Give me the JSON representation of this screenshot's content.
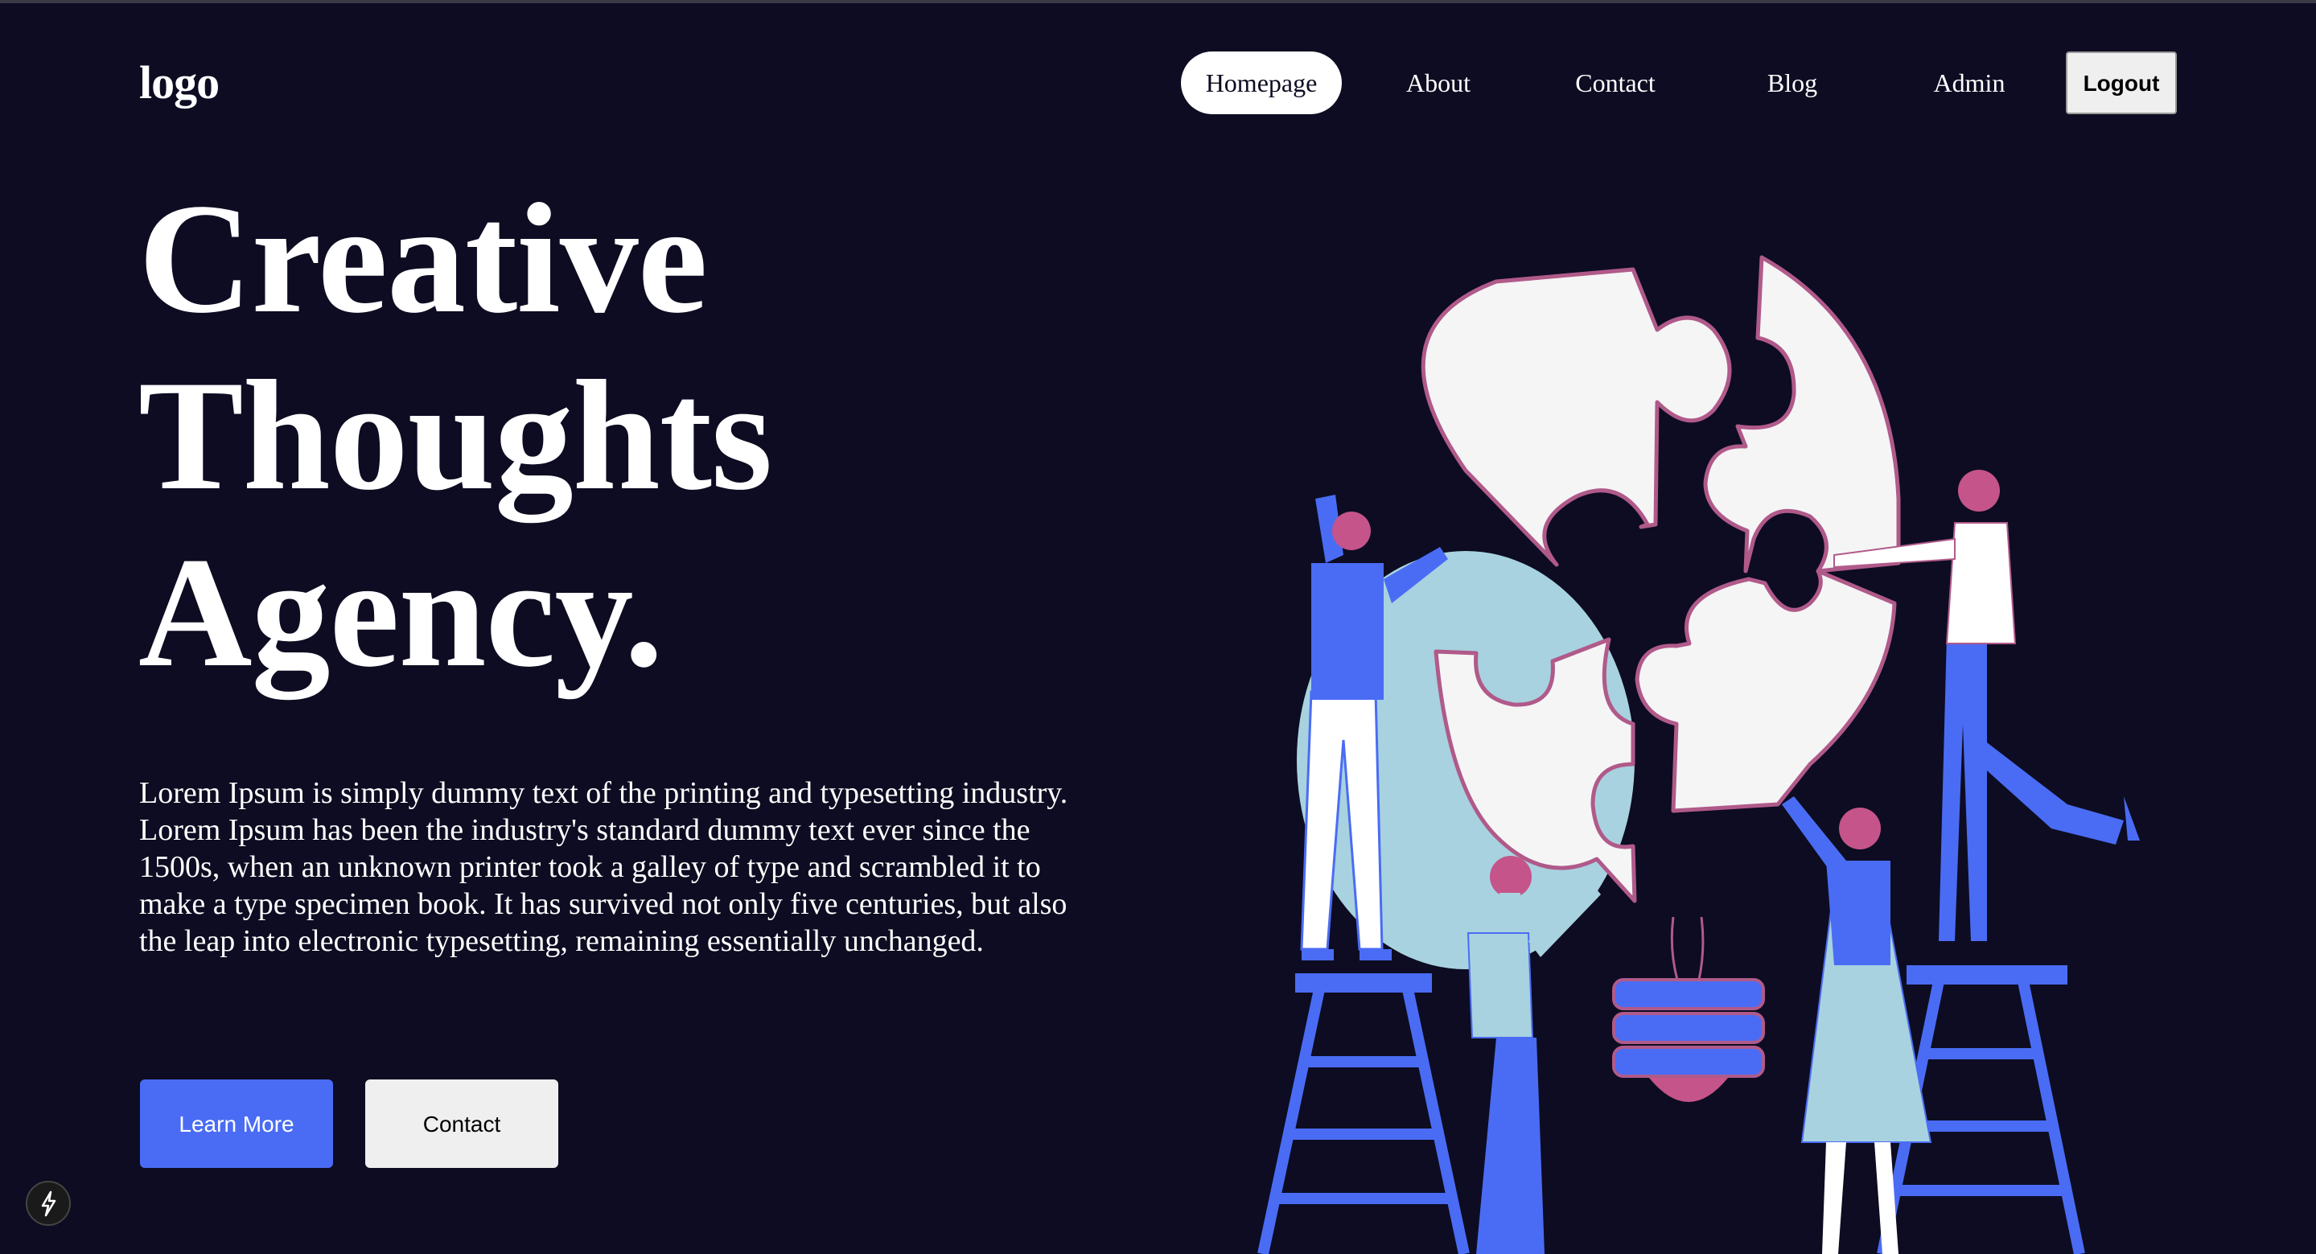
{
  "header": {
    "logo": "logo",
    "nav": [
      {
        "label": "Homepage",
        "active": true
      },
      {
        "label": "About",
        "active": false
      },
      {
        "label": "Contact",
        "active": false
      },
      {
        "label": "Blog",
        "active": false
      },
      {
        "label": "Admin",
        "active": false
      }
    ],
    "logout_label": "Logout"
  },
  "hero": {
    "title_lines": [
      "Creative",
      "Thoughts",
      "Agency."
    ],
    "description": "Lorem Ipsum is simply dummy text of the printing and typesetting industry. Lorem Ipsum has been the industry's standard dummy text ever since the 1500s, when an unknown printer took a galley of type and scrambled it to make a type specimen book. It has survived not only five centuries, but also the leap into electronic typesetting, remaining essentially unchanged.",
    "learn_more_label": "Learn More",
    "contact_label": "Contact"
  },
  "colors": {
    "background": "#0d0c22",
    "accent": "#4a6cf4",
    "puzzle_outline": "#b05a8a",
    "figure_blue": "#4a6cf4",
    "figure_light": "#a8d2df"
  },
  "icons": {
    "dev_badge": "lightning-icon"
  }
}
